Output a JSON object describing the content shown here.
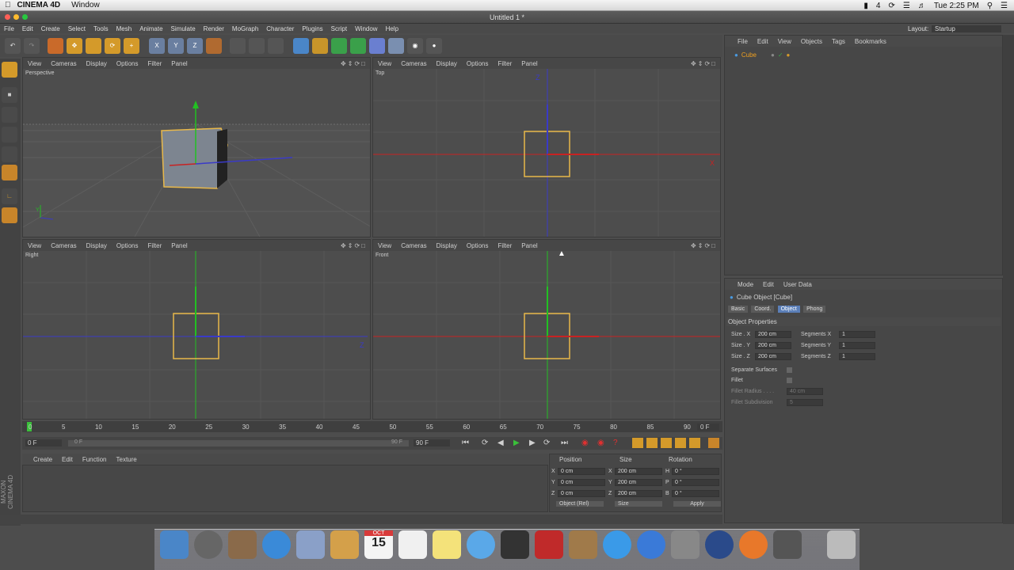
{
  "os_menubar": {
    "app": "CINEMA 4D",
    "menu": "Window",
    "clock": "Tue 2:25 PM",
    "badge": "4"
  },
  "window": {
    "title": "Untitled 1 *"
  },
  "app_menu": [
    "File",
    "Edit",
    "Create",
    "Select",
    "Tools",
    "Mesh",
    "Animate",
    "Simulate",
    "Render",
    "MoGraph",
    "Character",
    "Plugins",
    "Script",
    "Window",
    "Help"
  ],
  "layout": {
    "label": "Layout:",
    "value": "Startup"
  },
  "viewport_menu": [
    "View",
    "Cameras",
    "Display",
    "Options",
    "Filter",
    "Panel"
  ],
  "viewports": [
    {
      "name": "Perspective"
    },
    {
      "name": "Top"
    },
    {
      "name": "Right"
    },
    {
      "name": "Front"
    }
  ],
  "axis_labels": {
    "z": "Z",
    "x": "X",
    "y": "Y"
  },
  "object_manager": {
    "menu": [
      "File",
      "Edit",
      "View",
      "Objects",
      "Tags",
      "Bookmarks"
    ],
    "objects": [
      "Cube"
    ]
  },
  "attributes": {
    "menu": [
      "Mode",
      "Edit",
      "User Data"
    ],
    "title": "Cube Object [Cube]",
    "tabs": [
      "Basic",
      "Coord.",
      "Object",
      "Phong"
    ],
    "active_tab": "Object",
    "section": "Object Properties",
    "size_x_label": "Size . X",
    "size_x": "200 cm",
    "size_y_label": "Size . Y",
    "size_y": "200 cm",
    "size_z_label": "Size . Z",
    "size_z": "200 cm",
    "seg_x_label": "Segments X",
    "seg_x": "1",
    "seg_y_label": "Segments Y",
    "seg_y": "1",
    "seg_z_label": "Segments Z",
    "seg_z": "1",
    "separate_surfaces": "Separate Surfaces",
    "fillet": "Fillet",
    "fillet_radius_label": "Fillet Radius . . . .",
    "fillet_radius": "40 cm",
    "fillet_subdiv_label": "Fillet Subdivision",
    "fillet_subdiv": "5"
  },
  "timeline": {
    "ticks": [
      "0",
      "5",
      "10",
      "15",
      "20",
      "25",
      "30",
      "35",
      "40",
      "45",
      "50",
      "55",
      "60",
      "65",
      "70",
      "75",
      "80",
      "85",
      "90"
    ],
    "end_frame": "0 F",
    "start_field": "0 F",
    "slider_start": "0 F",
    "slider_end": "90 F",
    "max_field": "90 F"
  },
  "material_menu": [
    "Create",
    "Edit",
    "Function",
    "Texture"
  ],
  "coords": {
    "headers": [
      "Position",
      "Size",
      "Rotation"
    ],
    "rows": [
      {
        "axis": "X",
        "pos": "0 cm",
        "saxis": "X",
        "size": "200 cm",
        "raxis": "H",
        "rot": "0 °"
      },
      {
        "axis": "Y",
        "pos": "0 cm",
        "saxis": "Y",
        "size": "200 cm",
        "raxis": "P",
        "rot": "0 °"
      },
      {
        "axis": "Z",
        "pos": "0 cm",
        "saxis": "Z",
        "size": "200 cm",
        "raxis": "B",
        "rot": "0 °"
      }
    ],
    "mode": "Object (Rel)",
    "size_mode": "Size",
    "apply": "Apply"
  },
  "dock_calendar": {
    "month": "OCT",
    "day": "15"
  },
  "brand": "MAXON CINEMA 4D"
}
